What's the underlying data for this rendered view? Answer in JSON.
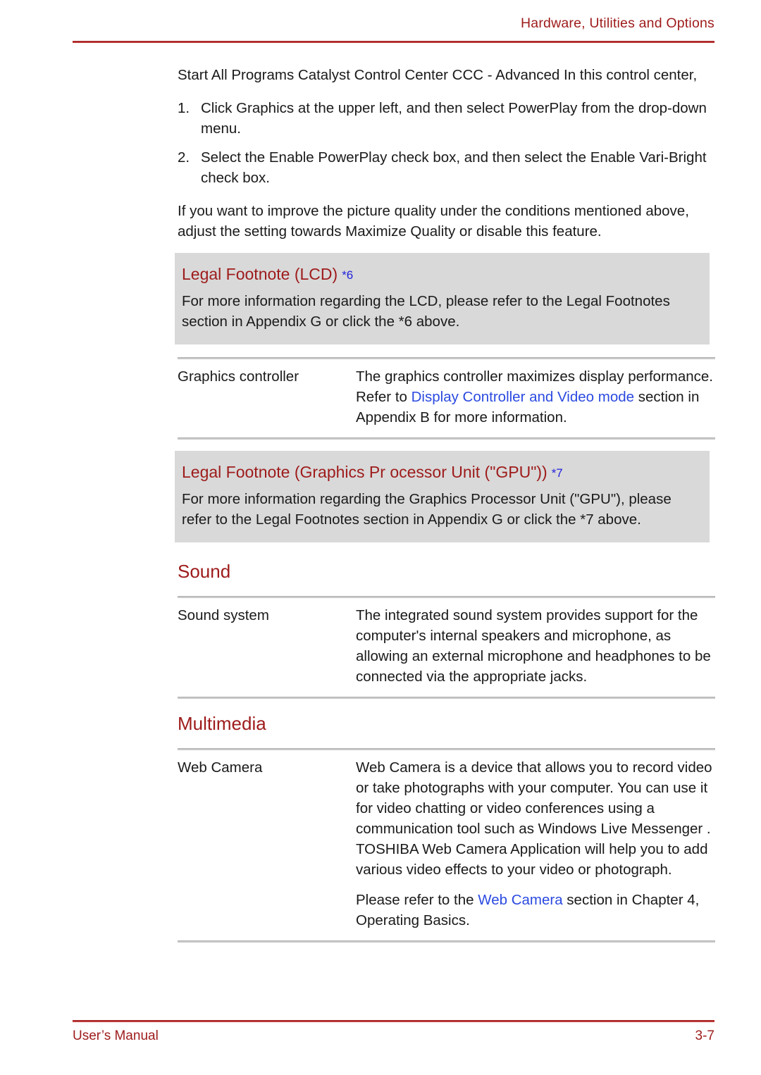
{
  "header": {
    "title": "Hardware, Utilities and Options"
  },
  "footer": {
    "left": "User’s Manual",
    "page_number": "3-7"
  },
  "colors": {
    "heading_red": "#9e1b1b",
    "rule_red": "#bc3b3b",
    "link_blue": "#2b4ae0",
    "ref_blue": "#2222dd",
    "note_box_grey": "#d9d9d9",
    "table_rule_grey": "#c9c9c9"
  },
  "intro": {
    "paragraph": "Start    All Programs      Catalyst Control Center       CCC - Advanced  In this control center,"
  },
  "steps": [
    {
      "marker": "1.",
      "text": "Click Graphics  at the upper left, and then select PowerPlay      from the drop-down menu."
    },
    {
      "marker": "2.",
      "text": "Select the Enable PowerPlay      check box, and then select the Enable Vari-Bright      check box."
    }
  ],
  "after_steps": {
    "paragraph": "If you want to improve the picture quality under the conditions mentioned above, adjust the setting towards Maximize Quality or disable this feature."
  },
  "note_lcd": {
    "title": "Legal Footnote (LCD)",
    "ref": "*6",
    "body": "For more information regarding the LCD, please refer to the Legal Footnotes section in Appendix G or click the *6 above."
  },
  "graphics_row": {
    "term": "Graphics controller",
    "desc_part1": "The graphics controller maximizes display performance. Refer to ",
    "desc_link": "Display Controller and Video mode",
    "desc_part2": " section in Appendix B for more information."
  },
  "note_gpu": {
    "title": "Legal Footnote (Graphics Pr   ocessor Unit (\"GPU\"))",
    "ref": "*7",
    "body": "For more information regarding the Graphics Processor Unit (\"GPU\"), please refer to the Legal Footnotes section in Appendix G or click the *7 above."
  },
  "sound_section": {
    "heading": "Sound",
    "row": {
      "term": "Sound system",
      "desc": "The integrated sound system provides support for the computer's internal speakers and microphone, as allowing an external microphone and headphones to be connected via the appropriate jacks."
    }
  },
  "multimedia_section": {
    "heading": "Multimedia",
    "row": {
      "term": "Web Camera",
      "desc_p1": "Web Camera  is a device that allows you to record video or take photographs with your computer. You can use it for video chatting or video conferences using a communication tool such as Windows Live Messenger  . TOSHIBA Web Camera Application    will help you to add various video effects to your video or photograph.",
      "desc_p2_part1": "Please refer to the ",
      "desc_p2_link": "Web Camera",
      "desc_p2_part2": " section in Chapter 4, Operating Basics."
    }
  }
}
